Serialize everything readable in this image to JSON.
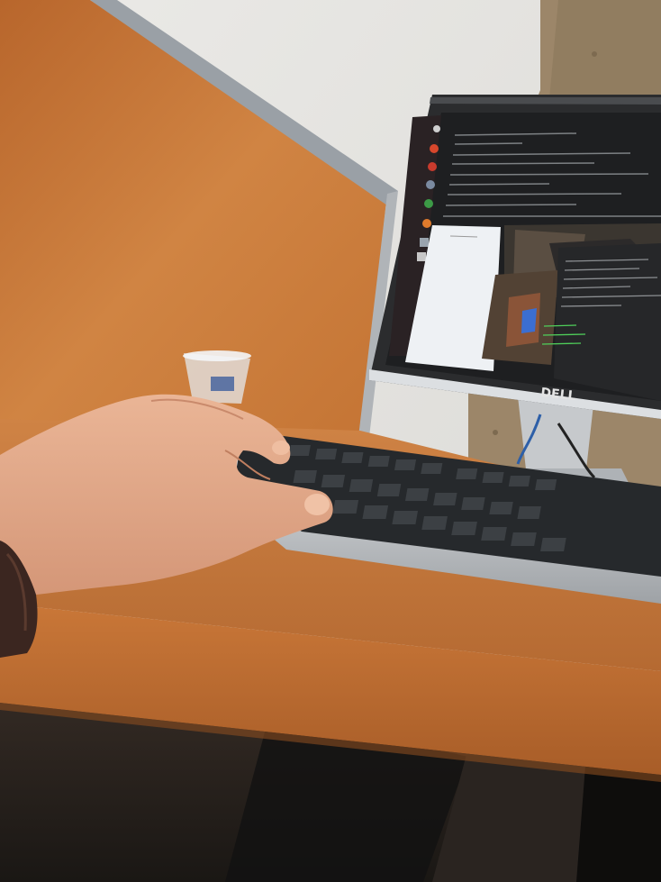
{
  "photo": {
    "monitor_brand": "DELL"
  },
  "colors": {
    "wall": "#e4e3e0",
    "partition_wood": "#c97a3a",
    "desk_wood": "#c2773d",
    "stone": "#9a8466",
    "keyboard": "#2a2d30",
    "screen_dark": "#1c1d1f",
    "skin": "#e0a98a"
  }
}
